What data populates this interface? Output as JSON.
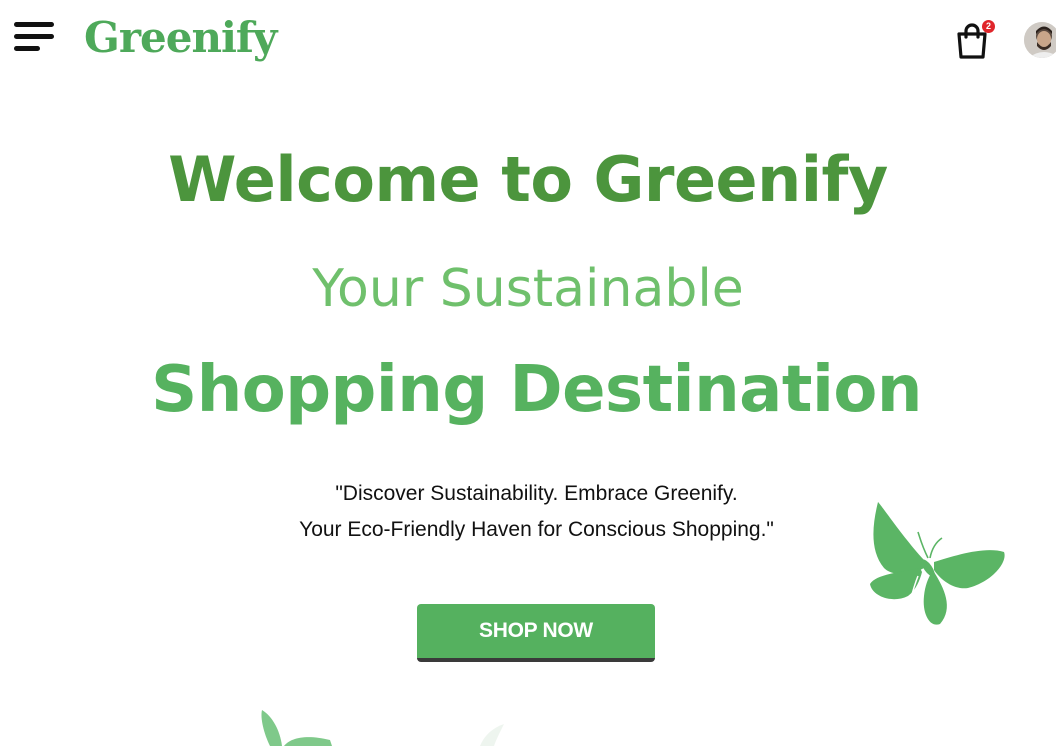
{
  "header": {
    "menu_icon": "hamburger-menu-icon",
    "logo_text": "Greenify",
    "cart_icon": "shopping-bag-icon",
    "cart_count": "2",
    "avatar_icon": "user-avatar"
  },
  "hero": {
    "title": "Welcome to Greenify",
    "subtitle_line1": "Your Sustainable",
    "subtitle_line2": "Shopping Destination",
    "tagline_line1": "\"Discover Sustainability. Embrace Greenify.",
    "tagline_line2": "Your Eco-Friendly Haven for Conscious Shopping.\"",
    "cta_label": "SHOP NOW"
  },
  "decorations": {
    "butterfly_icon": "butterfly-icon"
  },
  "colors": {
    "brand_green": "#4ea95a",
    "title_green": "#4c953d",
    "light_green": "#6fc06c",
    "button_green": "#55b15f",
    "badge_red": "#e0262b"
  }
}
